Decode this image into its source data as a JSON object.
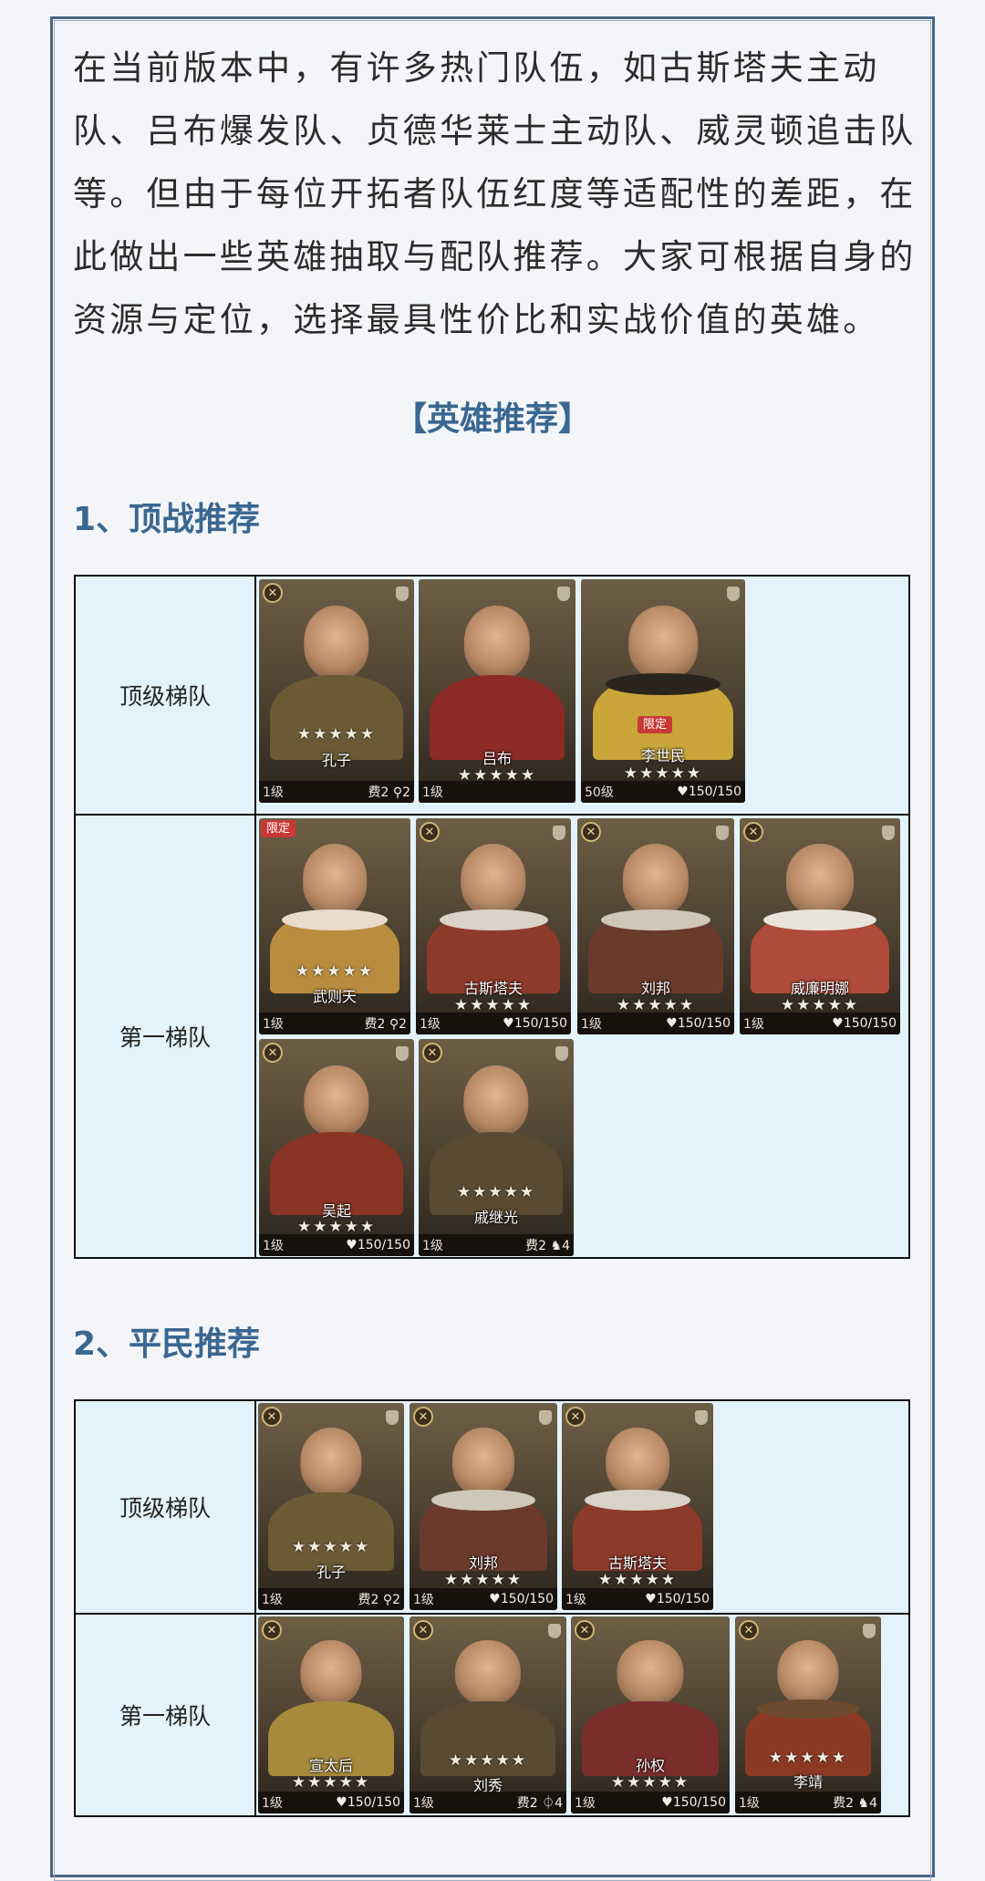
{
  "intro": "在当前版本中，有许多热门队伍，如古斯塔夫主动队、吕布爆发队、贞德华莱士主动队、威灵顿追击队等。但由于每位开拓者队伍红度等适配性的差距，在此做出一些英雄抽取与配队推荐。大家可根据自身的资源与定位，选择最具性价比和实战价值的英雄。",
  "recommend_title": "【英雄推荐】",
  "sections": [
    {
      "title": "1、顶战推荐",
      "tiers": [
        {
          "label": "顶级梯队",
          "heroes": [
            {
              "name": "孔子",
              "stars": "★★★★★",
              "level": "1级",
              "stat": "费2 ⚲2",
              "badge": true
            },
            {
              "name": "吕布",
              "stars": "★★★★★",
              "level": "1级",
              "stat": "",
              "badge": false
            },
            {
              "name": "李世民",
              "stars": "★★★★★",
              "level": "50级",
              "stat": "♥150/150",
              "badge": false,
              "tag": "限定"
            }
          ]
        },
        {
          "label": "第一梯队",
          "heroes": [
            {
              "name": "武则天",
              "stars": "★★★★★",
              "level": "1级",
              "stat": "费2 ⚲2",
              "badge": false,
              "tag": "限定"
            },
            {
              "name": "古斯塔夫",
              "stars": "★★★★★",
              "level": "1级",
              "stat": "♥150/150",
              "badge": true
            },
            {
              "name": "刘邦",
              "stars": "★★★★★",
              "level": "1级",
              "stat": "♥150/150",
              "badge": true
            },
            {
              "name": "威廉明娜",
              "stars": "★★★★★",
              "level": "1级",
              "stat": "♥150/150",
              "badge": true
            },
            {
              "name": "吴起",
              "stars": "★★★★★",
              "level": "1级",
              "stat": "♥150/150",
              "badge": true
            },
            {
              "name": "戚继光",
              "stars": "★★★★★",
              "level": "1级",
              "stat": "费2 ♞4",
              "badge": true
            }
          ]
        }
      ]
    },
    {
      "title": "2、平民推荐",
      "tiers": [
        {
          "label": "顶级梯队",
          "heroes": [
            {
              "name": "孔子",
              "stars": "★★★★★",
              "level": "1级",
              "stat": "费2 ⚲2",
              "badge": true
            },
            {
              "name": "刘邦",
              "stars": "★★★★★",
              "level": "1级",
              "stat": "♥150/150",
              "badge": true
            },
            {
              "name": "古斯塔夫",
              "stars": "★★★★★",
              "level": "1级",
              "stat": "♥150/150",
              "badge": true
            }
          ]
        },
        {
          "label": "第一梯队",
          "heroes": [
            {
              "name": "宣太后",
              "stars": "★★★★★",
              "level": "1级",
              "stat": "♥150/150",
              "badge": true
            },
            {
              "name": "刘秀",
              "stars": "★★★★★",
              "level": "1级",
              "stat": "费2 ⏀4",
              "badge": true
            },
            {
              "name": "孙权",
              "stars": "★★★★★",
              "level": "1级",
              "stat": "♥150/150",
              "badge": true
            },
            {
              "name": "李靖",
              "stars": "★★★★★",
              "level": "1级",
              "stat": "费2 ♞4",
              "badge": true
            }
          ]
        }
      ]
    }
  ]
}
